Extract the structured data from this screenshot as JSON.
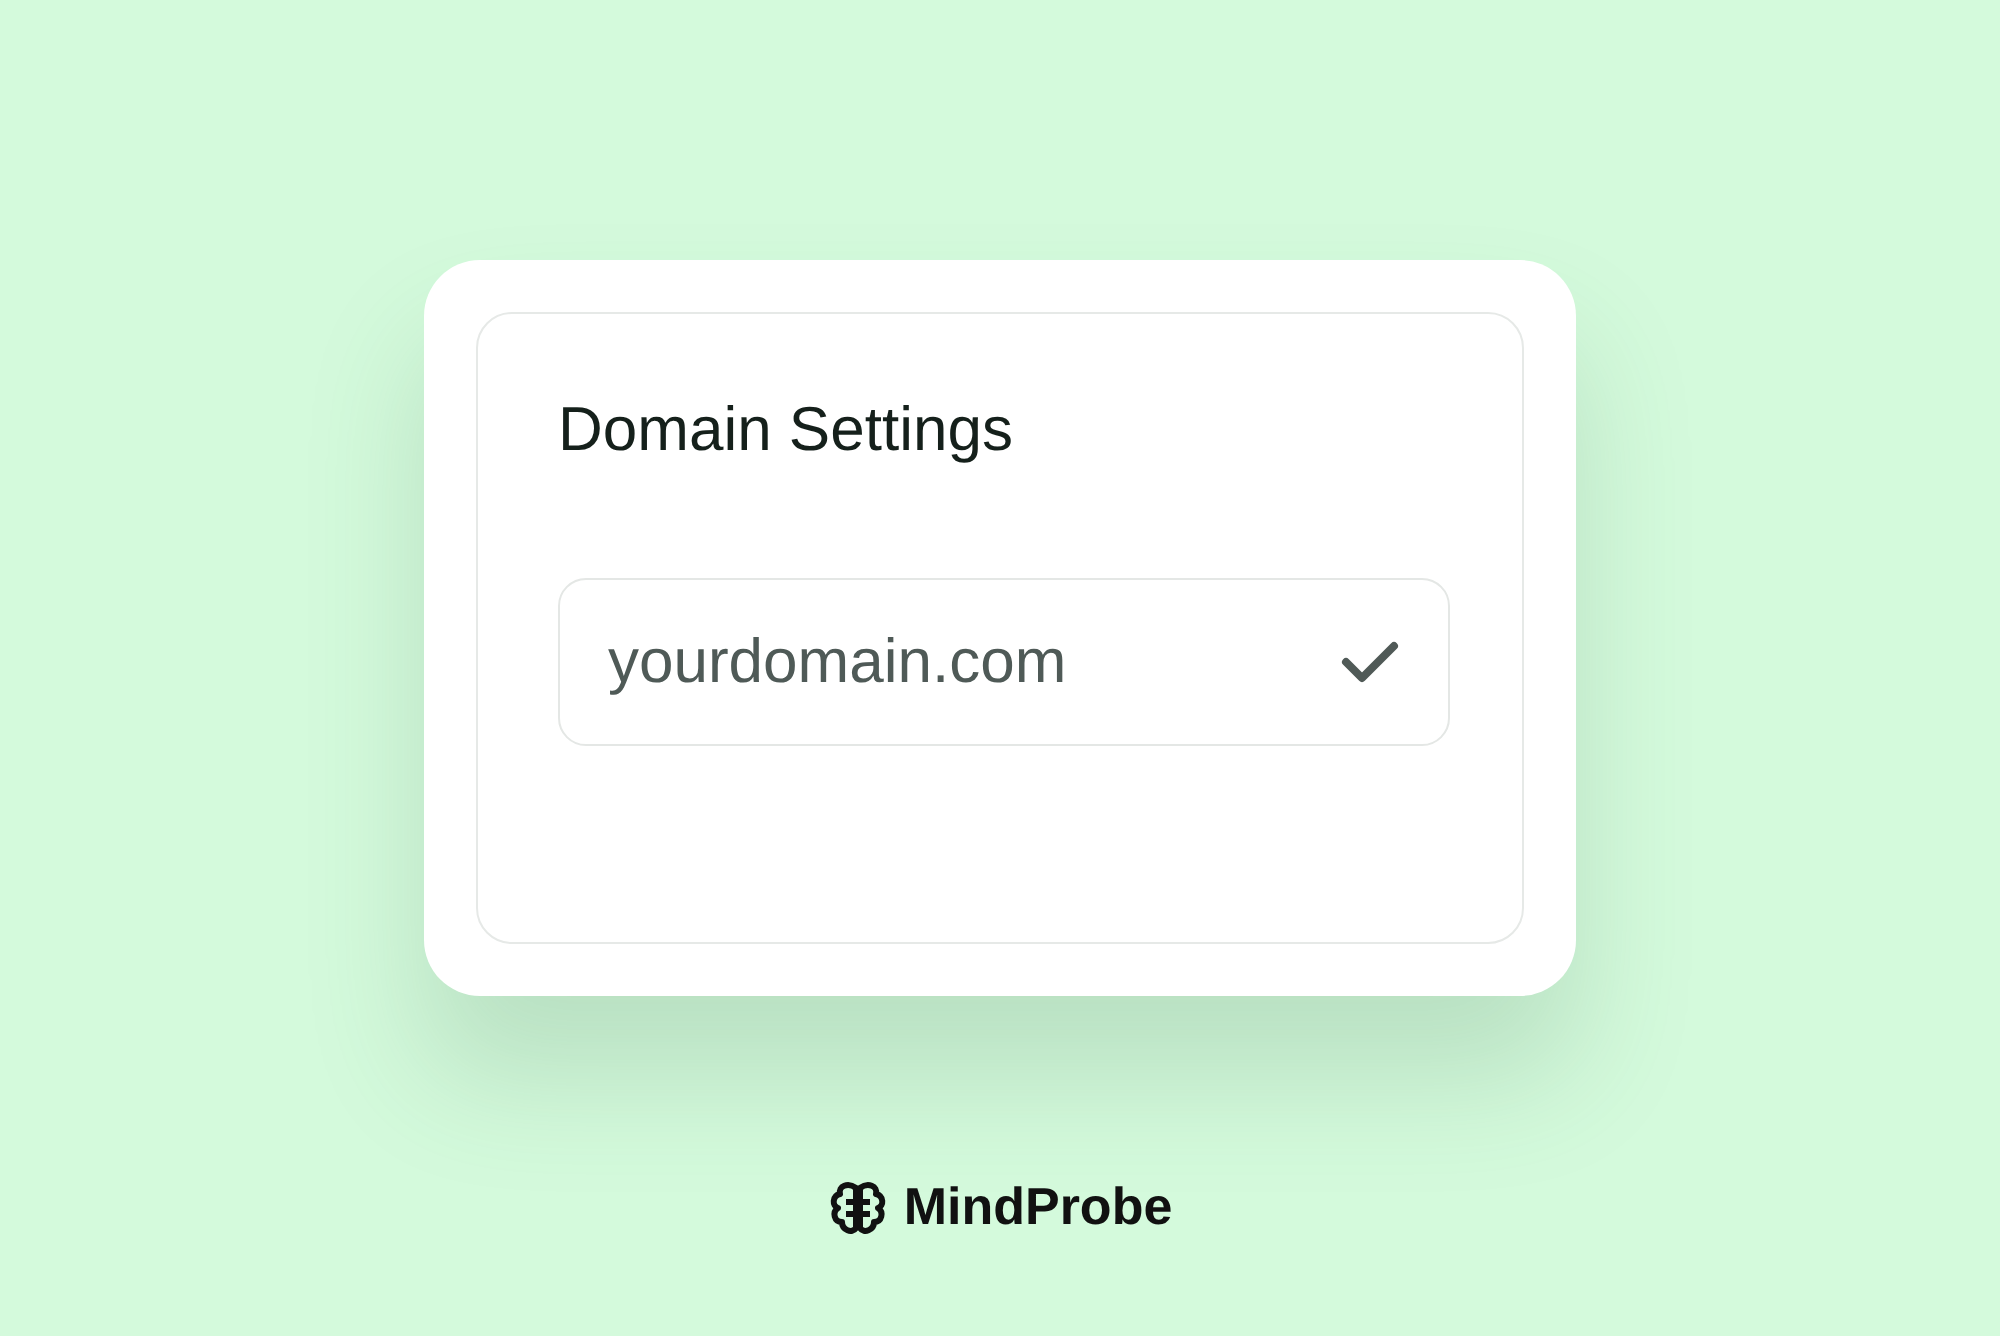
{
  "card": {
    "title": "Domain Settings",
    "domain_field": {
      "value": "yourdomain.com",
      "verified": true
    }
  },
  "brand": {
    "name": "MindProbe"
  }
}
